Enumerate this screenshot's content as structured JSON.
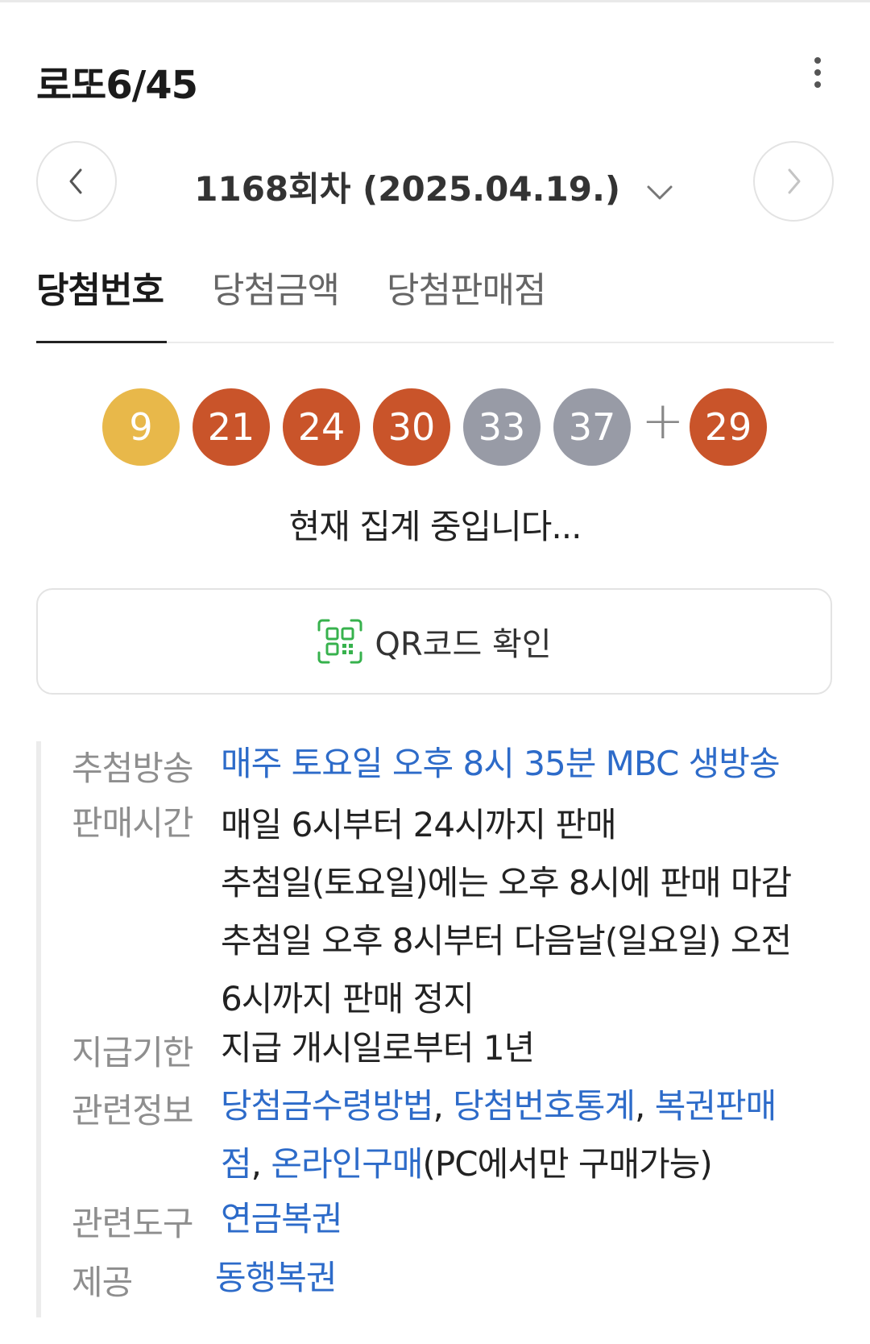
{
  "header": {
    "title": "로또6/45"
  },
  "round": {
    "label": "1168회차 (2025.04.19.)"
  },
  "tabs": [
    {
      "label": "당첨번호"
    },
    {
      "label": "당첨금액"
    },
    {
      "label": "당첨판매점"
    }
  ],
  "numbers": {
    "main": [
      {
        "value": "9",
        "color": "#e8b84a"
      },
      {
        "value": "21",
        "color": "#c9542a"
      },
      {
        "value": "24",
        "color": "#c9542a"
      },
      {
        "value": "30",
        "color": "#c9542a"
      },
      {
        "value": "33",
        "color": "#989ba6"
      },
      {
        "value": "37",
        "color": "#989ba6"
      }
    ],
    "plus": "+",
    "bonus": {
      "value": "29",
      "color": "#c9542a"
    }
  },
  "status": "현재 집계 중입니다...",
  "qr": {
    "label": "QR코드 확인",
    "icon": "qr-icon",
    "icon_color": "#37b24d"
  },
  "info": {
    "broadcast": {
      "label": "추첨방송",
      "value": "매주 토요일 오후 8시 35분 MBC 생방송"
    },
    "sales_time": {
      "label": "판매시간",
      "lines": [
        "매일 6시부터 24시까지 판매",
        "추첨일(토요일)에는 오후 8시에 판매 마감",
        "추첨일 오후 8시부터 다음날(일요일) 오전",
        "6시까지 판매 정지"
      ]
    },
    "deadline": {
      "label": "지급기한",
      "value": "지급 개시일로부터 1년"
    },
    "related_info": {
      "label": "관련정보",
      "link1": "당첨금수령방법",
      "sep1": ", ",
      "link2": "당첨번호통계",
      "sep2": ", ",
      "link3a": "복권판매",
      "link3b": "점",
      "sep3": ", ",
      "link4": "온라인구매",
      "note": "(PC에서만 구매가능)"
    },
    "related_tool": {
      "label": "관련도구",
      "value": "연금복권"
    },
    "provider": {
      "label": "제공",
      "value": "동행복권"
    }
  },
  "colors": {
    "link": "#2d6bc9",
    "label": "#8e8e8e"
  }
}
